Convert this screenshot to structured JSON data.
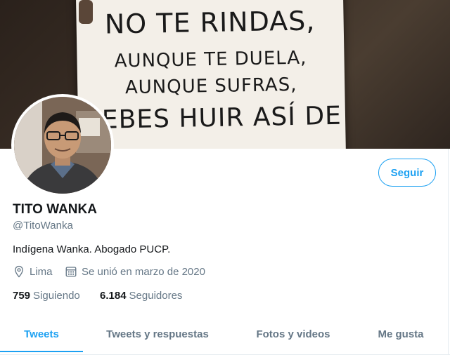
{
  "banner": {
    "poster_lines": [
      "NO TE RINDAS,",
      "AUNQUE TE DUELA,",
      "AUNQUE SUFRAS,",
      "DEBES HUIR ASÍ DE"
    ]
  },
  "profile": {
    "name": "TITO WANKA",
    "handle": "@TitoWanka",
    "bio": "Indígena Wanka. Abogado PUCP.",
    "location": "Lima",
    "joined": "Se unió en marzo de 2020",
    "following_count": "759",
    "following_label": "Siguiendo",
    "followers_count": "6.184",
    "followers_label": "Seguidores"
  },
  "follow_button": {
    "label": "Seguir"
  },
  "tabs": [
    {
      "label": "Tweets",
      "active": true
    },
    {
      "label": "Tweets y respuestas",
      "active": false
    },
    {
      "label": "Fotos y videos",
      "active": false
    },
    {
      "label": "Me gusta",
      "active": false
    }
  ],
  "colors": {
    "accent": "#1da1f2",
    "secondary_text": "#657786",
    "primary_text": "#14171a"
  },
  "icons": {
    "location": "location-pin-icon",
    "joined": "calendar-icon"
  }
}
